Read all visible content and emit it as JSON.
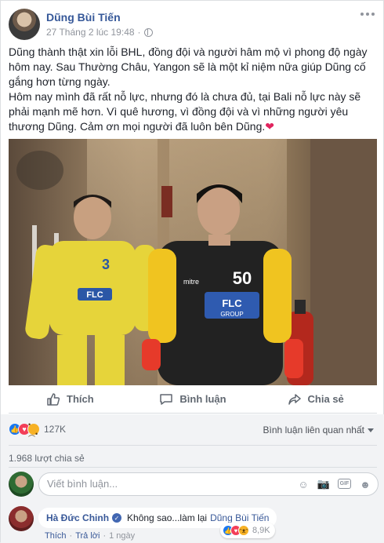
{
  "post": {
    "author": "Dũng Bùi Tiến",
    "timestamp": "27 Tháng 2 lúc 19:48",
    "dot": "·",
    "text_p1": "Dũng thành thật xin lỗi BHL, đồng đội và người hâm mộ vì phong độ ngày hôm nay. Sau Thường Châu, Yangon sẽ là một kỉ niệm nữa giúp Dũng cố gắng hơn từng ngày.",
    "text_p2": "Hôm nay mình đã rất nỗ lực, nhưng đó là chưa đủ, tại Bali nỗ lực này sẽ phải mạnh mẽ hơn. Vì quê hương, vì đồng đội và vì những người yêu thương Dũng. Cảm ơn mọi người đã luôn bên Dũng.",
    "heart": "❤"
  },
  "photo": {
    "left_player_number": "3",
    "right_player_number": "50",
    "sponsor": "FLC",
    "sponsor_sub": "GROUP",
    "brand": "mitre"
  },
  "actions": {
    "like": "Thích",
    "comment": "Bình luận",
    "share": "Chia sẻ"
  },
  "reactions": {
    "count": "127K",
    "sort_label": "Bình luận liên quan nhất"
  },
  "shares": "1.968 lượt chia sẻ",
  "comment_box": {
    "placeholder": "Viết bình luận..."
  },
  "comment": {
    "author": "Hà Đức Chinh",
    "text": "Không sao...làm lại",
    "tag": "Dũng Bùi Tiến",
    "reaction_count": "8,9K",
    "like": "Thích",
    "reply": "Trả lời",
    "time": "1 ngày",
    "dot": "·"
  },
  "colors": {
    "link": "#365899",
    "like_blue": "#1877f2",
    "love_red": "#f33e58"
  }
}
